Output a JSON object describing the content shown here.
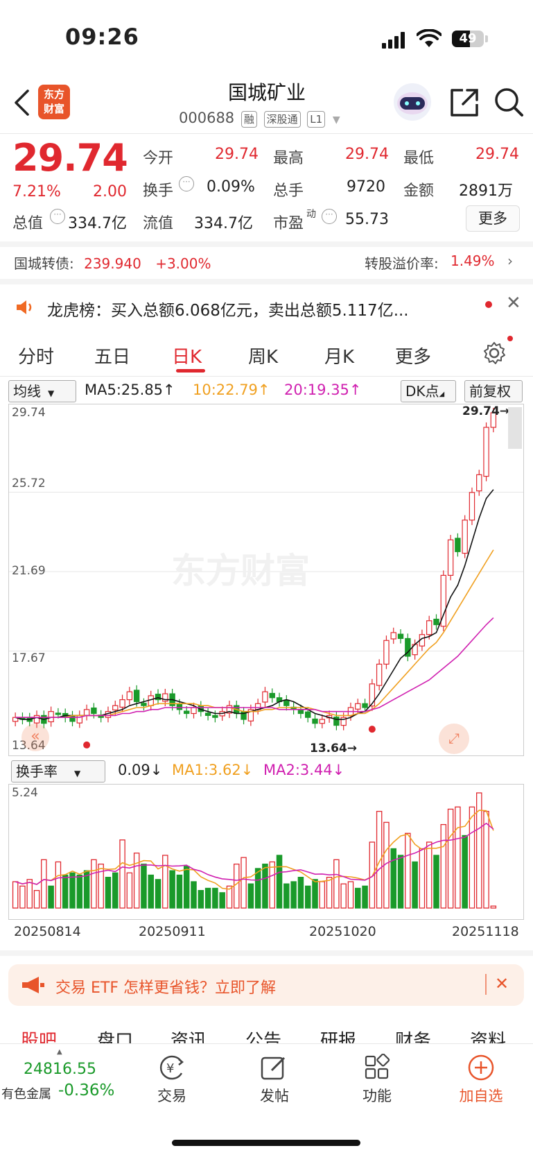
{
  "status_bar": {
    "time": "09:26",
    "battery": "49"
  },
  "header": {
    "title": "国城矿业",
    "code": "000688",
    "tags": [
      "融",
      "深股通",
      "L1"
    ]
  },
  "logo": {
    "line1": "东方",
    "line2": "财富"
  },
  "quote": {
    "price": "29.74",
    "change_pct": "7.21%",
    "change": "2.00",
    "open_label": "今开",
    "open": "29.74",
    "high_label": "最高",
    "high": "29.74",
    "low_label": "最低",
    "low": "29.74",
    "turnover_label": "换手",
    "turnover": "0.09%",
    "volume_label": "总手",
    "volume": "9720",
    "amount_label": "金额",
    "amount": "2891万",
    "total_cap_label": "总值",
    "total_cap": "334.7亿",
    "float_cap_label": "流值",
    "float_cap": "334.7亿",
    "pe_label": "市盈",
    "pe_sup": "动",
    "pe": "55.73",
    "more": "更多"
  },
  "convertible": {
    "label": "国城转债:",
    "price": "239.940",
    "change": "+3.00%",
    "premium_label": "转股溢价率:",
    "premium": "1.49%"
  },
  "notice": {
    "text": "龙虎榜：买入总额6.068亿元，卖出总额5.117亿..."
  },
  "tabs": [
    "分时",
    "五日",
    "日K",
    "周K",
    "月K",
    "更多"
  ],
  "ma": {
    "select": "均线",
    "ma5": "MA5:25.85↑",
    "ma10": "10:22.79↑",
    "ma20": "20:19.35↑",
    "dk": "DK点",
    "adj": "前复权"
  },
  "chart": {
    "y_labels": [
      "29.74",
      "25.72",
      "21.69",
      "17.67",
      "13.64"
    ],
    "high_marker": "29.74→",
    "low_marker": "13.64→",
    "watermark": "东方财富"
  },
  "turnover_panel": {
    "select": "换手率",
    "value": "0.09↓",
    "ma1": "MA1:3.62↓",
    "ma2": "MA2:3.44↓",
    "max_label": "5.24"
  },
  "dates": [
    "20250814",
    "20250911",
    "20251020",
    "20251118"
  ],
  "banner": {
    "text": "交易 ETF 怎样更省钱？立即了解"
  },
  "bottom_tabs": [
    "股吧",
    "盘口",
    "资讯",
    "公告",
    "研报",
    "财务",
    "资料"
  ],
  "bottom_bar": {
    "index_value": "24816.55",
    "index_name": "有色金属",
    "index_change": "-0.36%",
    "trade": "交易",
    "post": "发帖",
    "func": "功能",
    "add": "加自选"
  },
  "colors": {
    "up": "#e0282f",
    "down": "#1a9a2a",
    "ma10": "#f0a020",
    "ma20": "#d020b0"
  },
  "chart_data": {
    "type": "candlestick",
    "closes": [
      14.3,
      14.2,
      14.1,
      14.4,
      14.0,
      14.6,
      14.5,
      14.3,
      14.1,
      14.4,
      14.7,
      14.5,
      14.3,
      14.6,
      14.9,
      15.2,
      15.6,
      15.1,
      14.9,
      15.4,
      15.2,
      15.5,
      14.9,
      14.7,
      14.5,
      14.8,
      14.6,
      14.4,
      14.3,
      14.6,
      14.9,
      14.5,
      14.2,
      14.7,
      15.0,
      15.6,
      15.3,
      15.1,
      14.9,
      14.7,
      14.5,
      14.3,
      14.0,
      14.2,
      14.4,
      13.9,
      14.3,
      14.8,
      15.0,
      14.8,
      16.0,
      17.0,
      18.2,
      18.6,
      18.3,
      17.4,
      18.0,
      18.5,
      19.2,
      19.0,
      21.5,
      23.3,
      22.7,
      24.3,
      25.7,
      26.6,
      29.0,
      29.74
    ],
    "ma5": [
      14.3,
      14.2,
      14.2,
      14.3,
      14.2,
      14.3,
      14.3,
      14.4,
      14.4,
      14.4,
      14.4,
      14.4,
      14.4,
      14.5,
      14.6,
      14.7,
      14.9,
      15.0,
      15.1,
      15.2,
      15.3,
      15.2,
      15.2,
      15.1,
      15.0,
      14.9,
      14.7,
      14.6,
      14.5,
      14.5,
      14.6,
      14.5,
      14.5,
      14.6,
      14.7,
      14.8,
      14.9,
      15.1,
      15.2,
      15.1,
      14.9,
      14.7,
      14.5,
      14.4,
      14.3,
      14.2,
      14.2,
      14.3,
      14.5,
      14.6,
      15.0,
      15.5,
      16.1,
      16.7,
      17.3,
      17.6,
      18.0,
      18.3,
      18.4,
      18.6,
      19.5,
      20.4,
      21.0,
      22.0,
      23.2,
      24.4,
      25.4,
      25.85
    ],
    "ma10": [
      14.3,
      14.3,
      14.3,
      14.3,
      14.3,
      14.3,
      14.3,
      14.3,
      14.4,
      14.4,
      14.4,
      14.4,
      14.4,
      14.4,
      14.5,
      14.6,
      14.7,
      14.8,
      14.8,
      14.9,
      15.0,
      15.0,
      15.0,
      15.0,
      15.0,
      15.0,
      14.9,
      14.9,
      14.8,
      14.8,
      14.8,
      14.7,
      14.6,
      14.6,
      14.6,
      14.7,
      14.7,
      14.8,
      14.8,
      14.8,
      14.8,
      14.8,
      14.7,
      14.6,
      14.5,
      14.4,
      14.4,
      14.4,
      14.5,
      14.5,
      14.7,
      15.0,
      15.4,
      15.8,
      16.2,
      16.6,
      17.0,
      17.4,
      17.8,
      18.1,
      18.6,
      19.2,
      19.8,
      20.4,
      21.0,
      21.6,
      22.2,
      22.79
    ],
    "ma20": [
      14.3,
      14.3,
      14.3,
      14.3,
      14.3,
      14.3,
      14.3,
      14.3,
      14.3,
      14.3,
      14.4,
      14.4,
      14.4,
      14.4,
      14.4,
      14.5,
      14.5,
      14.6,
      14.6,
      14.7,
      14.7,
      14.8,
      14.8,
      14.8,
      14.8,
      14.8,
      14.8,
      14.8,
      14.8,
      14.8,
      14.8,
      14.8,
      14.8,
      14.8,
      14.8,
      14.8,
      14.8,
      14.7,
      14.7,
      14.7,
      14.7,
      14.7,
      14.7,
      14.6,
      14.6,
      14.6,
      14.6,
      14.6,
      14.6,
      14.6,
      14.7,
      14.8,
      15.0,
      15.2,
      15.4,
      15.6,
      15.8,
      16.0,
      16.2,
      16.5,
      16.8,
      17.1,
      17.4,
      17.8,
      18.2,
      18.6,
      19.0,
      19.35
    ],
    "turnover": [
      1.2,
      1.0,
      1.3,
      0.8,
      2.2,
      1.0,
      2.1,
      1.5,
      1.6,
      1.5,
      1.7,
      2.2,
      2.0,
      1.4,
      1.6,
      3.1,
      1.6,
      2.5,
      2.0,
      1.5,
      1.3,
      2.4,
      1.7,
      1.5,
      1.9,
      1.2,
      0.8,
      0.9,
      0.9,
      0.7,
      1.0,
      2.0,
      2.3,
      1.1,
      1.8,
      2.0,
      2.1,
      2.4,
      1.1,
      1.2,
      1.4,
      1.0,
      1.3,
      1.2,
      1.4,
      2.2,
      1.1,
      1.2,
      0.9,
      1.0,
      3.0,
      4.4,
      3.9,
      2.7,
      2.4,
      3.4,
      2.1,
      2.7,
      3.0,
      2.4,
      3.8,
      4.5,
      4.6,
      3.3,
      4.6,
      5.24,
      4.4,
      0.09
    ],
    "turnover_up": [
      1,
      1,
      1,
      1,
      1,
      0,
      1,
      0,
      0,
      0,
      0,
      1,
      1,
      0,
      0,
      1,
      1,
      1,
      0,
      0,
      0,
      1,
      0,
      0,
      0,
      0,
      0,
      0,
      0,
      0,
      1,
      1,
      1,
      0,
      0,
      0,
      1,
      0,
      0,
      0,
      0,
      0,
      0,
      1,
      1,
      1,
      1,
      1,
      0,
      0,
      1,
      1,
      1,
      0,
      0,
      1,
      0,
      1,
      1,
      0,
      1,
      1,
      1,
      0,
      1,
      1,
      1,
      1
    ]
  }
}
